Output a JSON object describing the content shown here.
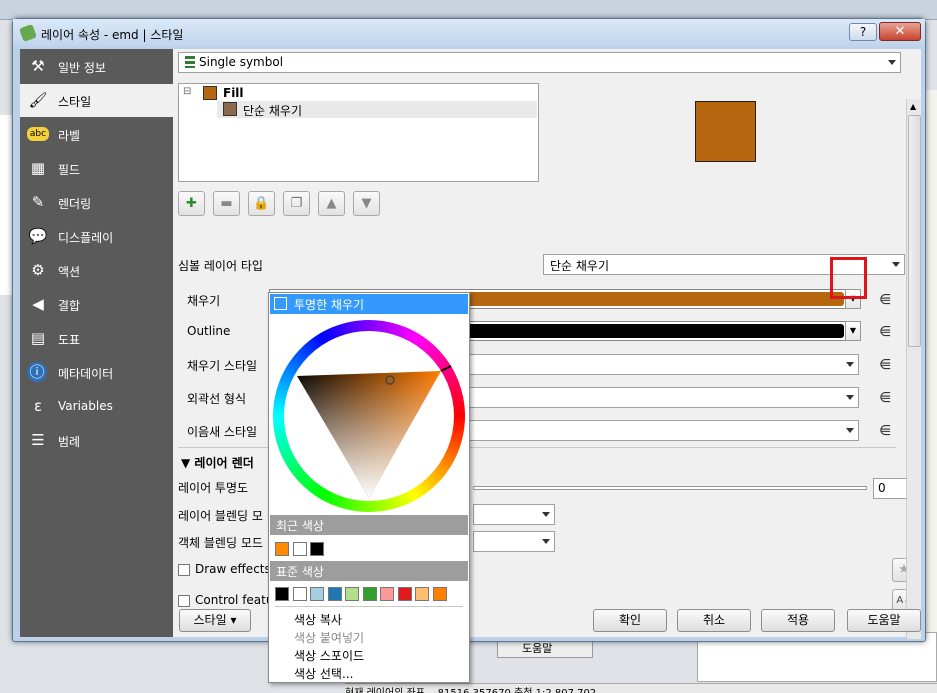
{
  "dialog": {
    "title": "레이어 속성 - emd | 스타일",
    "help_label": "?",
    "close_label": "✕"
  },
  "sidebar": {
    "items": [
      {
        "label": "일반 정보",
        "icon": "tools-icon"
      },
      {
        "label": "스타일",
        "icon": "brush-icon"
      },
      {
        "label": "라벨",
        "icon": "abc-label-icon"
      },
      {
        "label": "필드",
        "icon": "table-icon"
      },
      {
        "label": "렌더링",
        "icon": "paintbrush-icon"
      },
      {
        "label": "디스플레이",
        "icon": "speech-bubble-icon"
      },
      {
        "label": "액션",
        "icon": "gear-icon"
      },
      {
        "label": "결합",
        "icon": "join-icon"
      },
      {
        "label": "도표",
        "icon": "chart-icon"
      },
      {
        "label": "메타데이터",
        "icon": "info-icon"
      },
      {
        "label": "Variables",
        "icon": "epsilon-icon"
      },
      {
        "label": "범례",
        "icon": "legend-icon"
      }
    ],
    "active_index": 1
  },
  "style": {
    "renderer_value": "Single symbol",
    "tree": {
      "root_label": "Fill",
      "child_label": "단순 채우기"
    },
    "symbol_layer_type_label": "심볼 레이어 타입",
    "symbol_layer_type_value": "단순 채우기",
    "fill_label": "채우기",
    "fill_color": "#b5660e",
    "outline_label": "Outline",
    "outline_color": "#000000",
    "fill_style_label": "채우기 스타일",
    "stroke_style_label": "외곽선 형식",
    "join_style_label": "이음새 스타일",
    "layer_rendering_header": "레이어 렌더",
    "layer_transparency_label": "레이어 투명도",
    "layer_transparency_value": "0",
    "layer_blend_label": "레이어 블렌딩 모",
    "feature_blend_label": "객체 블렌딩 모드",
    "draw_effects_label": "Draw effects",
    "control_feature_label": "Control featur"
  },
  "buttons": {
    "style": "스타일",
    "ok": "확인",
    "cancel": "취소",
    "apply": "적용",
    "help": "도움말"
  },
  "color_popup": {
    "transparent_fill": "투명한 채우기",
    "recent_colors_header": "최근 색상",
    "recent_colors": [
      "#ff8c00",
      "#ffffff",
      "#000000"
    ],
    "standard_colors_header": "표준 색상",
    "standard_colors": [
      "#000000",
      "#ffffff",
      "#a6cee3",
      "#1f78b4",
      "#b2df8a",
      "#33a02c",
      "#fb9a99",
      "#e31a1c",
      "#fdbf6f",
      "#ff7f00"
    ],
    "menu_copy": "색상 복사",
    "menu_paste": "색상 붙여넣기",
    "menu_pick": "색상 스포이드",
    "menu_choose": "색상 선택..."
  },
  "background": {
    "ok_behind": "도움말",
    "status_text": "현재 레이어의 좌표   ...81516,357670   축척 1:2,807,702"
  }
}
